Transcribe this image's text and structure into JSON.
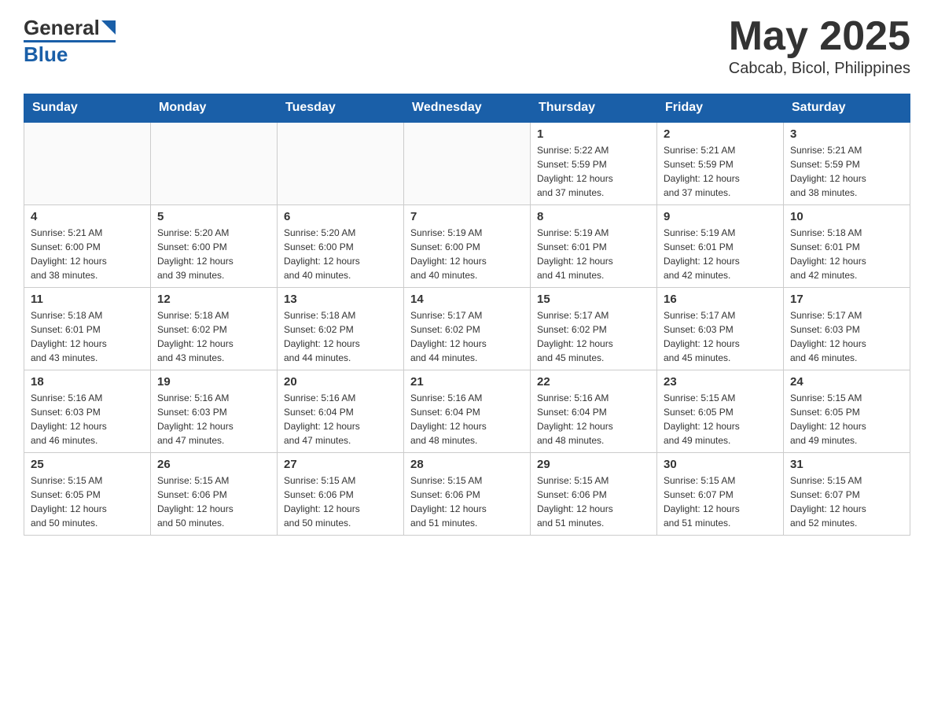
{
  "header": {
    "logo_general": "General",
    "logo_blue": "Blue",
    "month": "May 2025",
    "location": "Cabcab, Bicol, Philippines"
  },
  "days_of_week": [
    "Sunday",
    "Monday",
    "Tuesday",
    "Wednesday",
    "Thursday",
    "Friday",
    "Saturday"
  ],
  "weeks": [
    [
      {
        "day": "",
        "info": ""
      },
      {
        "day": "",
        "info": ""
      },
      {
        "day": "",
        "info": ""
      },
      {
        "day": "",
        "info": ""
      },
      {
        "day": "1",
        "info": "Sunrise: 5:22 AM\nSunset: 5:59 PM\nDaylight: 12 hours\nand 37 minutes."
      },
      {
        "day": "2",
        "info": "Sunrise: 5:21 AM\nSunset: 5:59 PM\nDaylight: 12 hours\nand 37 minutes."
      },
      {
        "day": "3",
        "info": "Sunrise: 5:21 AM\nSunset: 5:59 PM\nDaylight: 12 hours\nand 38 minutes."
      }
    ],
    [
      {
        "day": "4",
        "info": "Sunrise: 5:21 AM\nSunset: 6:00 PM\nDaylight: 12 hours\nand 38 minutes."
      },
      {
        "day": "5",
        "info": "Sunrise: 5:20 AM\nSunset: 6:00 PM\nDaylight: 12 hours\nand 39 minutes."
      },
      {
        "day": "6",
        "info": "Sunrise: 5:20 AM\nSunset: 6:00 PM\nDaylight: 12 hours\nand 40 minutes."
      },
      {
        "day": "7",
        "info": "Sunrise: 5:19 AM\nSunset: 6:00 PM\nDaylight: 12 hours\nand 40 minutes."
      },
      {
        "day": "8",
        "info": "Sunrise: 5:19 AM\nSunset: 6:01 PM\nDaylight: 12 hours\nand 41 minutes."
      },
      {
        "day": "9",
        "info": "Sunrise: 5:19 AM\nSunset: 6:01 PM\nDaylight: 12 hours\nand 42 minutes."
      },
      {
        "day": "10",
        "info": "Sunrise: 5:18 AM\nSunset: 6:01 PM\nDaylight: 12 hours\nand 42 minutes."
      }
    ],
    [
      {
        "day": "11",
        "info": "Sunrise: 5:18 AM\nSunset: 6:01 PM\nDaylight: 12 hours\nand 43 minutes."
      },
      {
        "day": "12",
        "info": "Sunrise: 5:18 AM\nSunset: 6:02 PM\nDaylight: 12 hours\nand 43 minutes."
      },
      {
        "day": "13",
        "info": "Sunrise: 5:18 AM\nSunset: 6:02 PM\nDaylight: 12 hours\nand 44 minutes."
      },
      {
        "day": "14",
        "info": "Sunrise: 5:17 AM\nSunset: 6:02 PM\nDaylight: 12 hours\nand 44 minutes."
      },
      {
        "day": "15",
        "info": "Sunrise: 5:17 AM\nSunset: 6:02 PM\nDaylight: 12 hours\nand 45 minutes."
      },
      {
        "day": "16",
        "info": "Sunrise: 5:17 AM\nSunset: 6:03 PM\nDaylight: 12 hours\nand 45 minutes."
      },
      {
        "day": "17",
        "info": "Sunrise: 5:17 AM\nSunset: 6:03 PM\nDaylight: 12 hours\nand 46 minutes."
      }
    ],
    [
      {
        "day": "18",
        "info": "Sunrise: 5:16 AM\nSunset: 6:03 PM\nDaylight: 12 hours\nand 46 minutes."
      },
      {
        "day": "19",
        "info": "Sunrise: 5:16 AM\nSunset: 6:03 PM\nDaylight: 12 hours\nand 47 minutes."
      },
      {
        "day": "20",
        "info": "Sunrise: 5:16 AM\nSunset: 6:04 PM\nDaylight: 12 hours\nand 47 minutes."
      },
      {
        "day": "21",
        "info": "Sunrise: 5:16 AM\nSunset: 6:04 PM\nDaylight: 12 hours\nand 48 minutes."
      },
      {
        "day": "22",
        "info": "Sunrise: 5:16 AM\nSunset: 6:04 PM\nDaylight: 12 hours\nand 48 minutes."
      },
      {
        "day": "23",
        "info": "Sunrise: 5:15 AM\nSunset: 6:05 PM\nDaylight: 12 hours\nand 49 minutes."
      },
      {
        "day": "24",
        "info": "Sunrise: 5:15 AM\nSunset: 6:05 PM\nDaylight: 12 hours\nand 49 minutes."
      }
    ],
    [
      {
        "day": "25",
        "info": "Sunrise: 5:15 AM\nSunset: 6:05 PM\nDaylight: 12 hours\nand 50 minutes."
      },
      {
        "day": "26",
        "info": "Sunrise: 5:15 AM\nSunset: 6:06 PM\nDaylight: 12 hours\nand 50 minutes."
      },
      {
        "day": "27",
        "info": "Sunrise: 5:15 AM\nSunset: 6:06 PM\nDaylight: 12 hours\nand 50 minutes."
      },
      {
        "day": "28",
        "info": "Sunrise: 5:15 AM\nSunset: 6:06 PM\nDaylight: 12 hours\nand 51 minutes."
      },
      {
        "day": "29",
        "info": "Sunrise: 5:15 AM\nSunset: 6:06 PM\nDaylight: 12 hours\nand 51 minutes."
      },
      {
        "day": "30",
        "info": "Sunrise: 5:15 AM\nSunset: 6:07 PM\nDaylight: 12 hours\nand 51 minutes."
      },
      {
        "day": "31",
        "info": "Sunrise: 5:15 AM\nSunset: 6:07 PM\nDaylight: 12 hours\nand 52 minutes."
      }
    ]
  ]
}
